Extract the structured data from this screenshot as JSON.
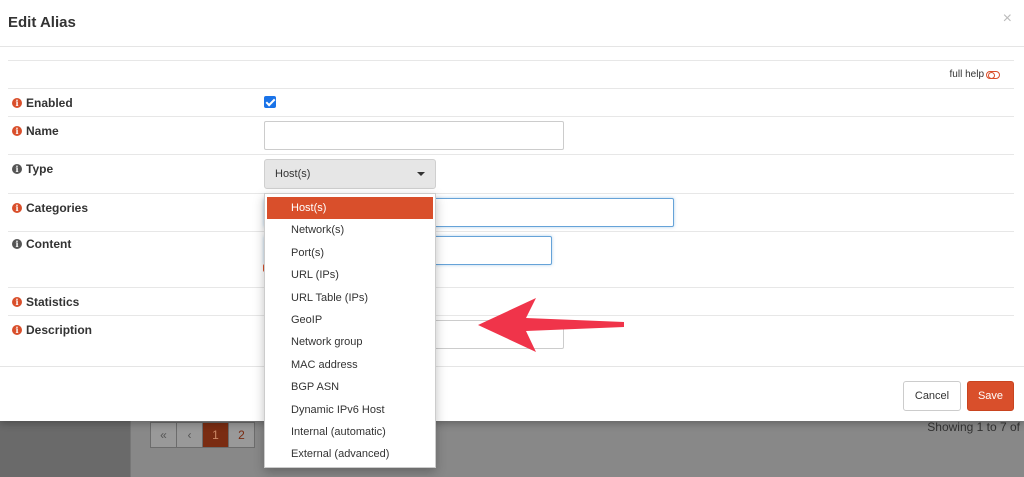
{
  "modal": {
    "title": "Edit Alias",
    "close_glyph": "×",
    "full_help_label": "full help"
  },
  "fields": {
    "enabled": {
      "label": "Enabled",
      "checked": true
    },
    "name": {
      "label": "Name",
      "value": ""
    },
    "type": {
      "label": "Type",
      "value": "Host(s)"
    },
    "categories": {
      "label": "Categories",
      "value": ""
    },
    "content": {
      "label": "Content",
      "value": ""
    },
    "statistics": {
      "label": "Statistics"
    },
    "description": {
      "label": "Description",
      "value": ""
    }
  },
  "type_options": [
    "Host(s)",
    "Network(s)",
    "Port(s)",
    "URL (IPs)",
    "URL Table (IPs)",
    "GeoIP",
    "Network group",
    "MAC address",
    "BGP ASN",
    "Dynamic IPv6 Host",
    "Internal (automatic)",
    "External (advanced)"
  ],
  "footer": {
    "cancel_label": "Cancel",
    "save_label": "Save"
  },
  "background": {
    "pager": [
      "«",
      "‹",
      "1",
      "2"
    ],
    "showing_text": "Showing 1 to 7 of"
  },
  "colors": {
    "accent": "#d94f2b",
    "checkbox": "#1a73e8"
  }
}
